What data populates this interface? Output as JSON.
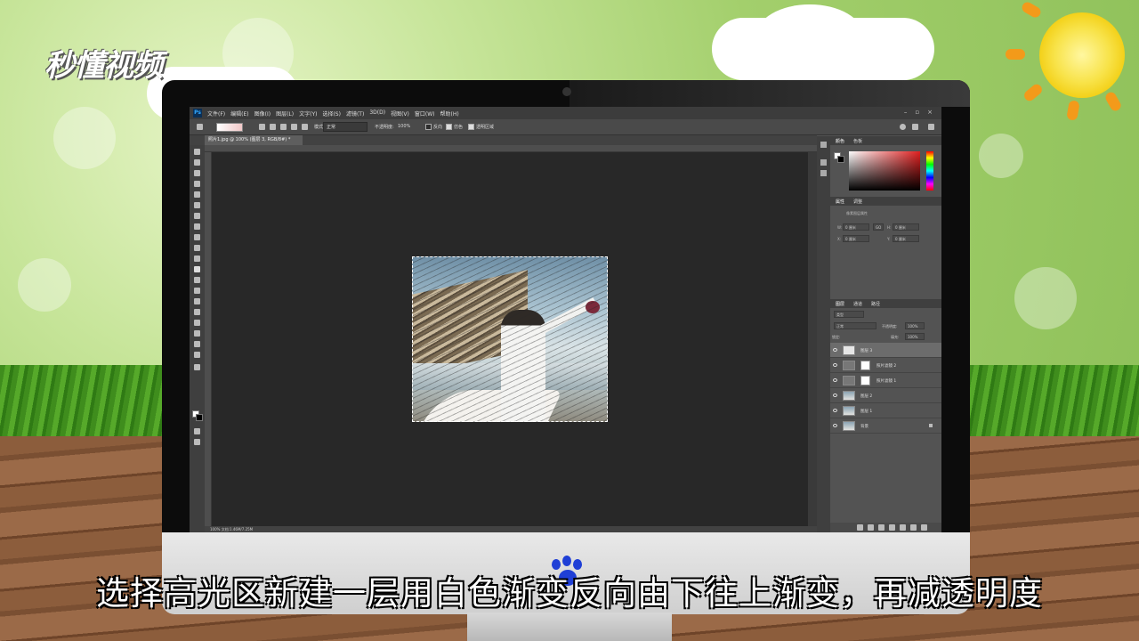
{
  "watermark": {
    "logo_text": "秒懂视频"
  },
  "subtitle": "选择高光区新建一层用白色渐变反向由下往上渐变，再减透明度",
  "photoshop": {
    "menu": [
      "文件(F)",
      "编辑(E)",
      "图像(I)",
      "图层(L)",
      "文字(Y)",
      "选择(S)",
      "滤镜(T)",
      "3D(D)",
      "视图(V)",
      "窗口(W)",
      "帮助(H)"
    ],
    "options": {
      "mode_label": "模式:",
      "mode_value": "正常",
      "opacity_label": "不透明度:",
      "opacity_value": "100%",
      "reverse_label": "反向",
      "dither_label": "仿色",
      "transparency_label": "透明区域"
    },
    "document_tab": "照片1.jpg @ 100% (图层 3, RGB/8#) *",
    "statusbar": "100%    文档:1.46M/7.25M",
    "panels": {
      "color_tabs": [
        "颜色",
        "色板"
      ],
      "props_tabs": [
        "属性",
        "调整"
      ],
      "props_title": "像素图层属性",
      "props_fields": {
        "w_label": "W:",
        "w_value": "0 厘米",
        "h_label": "H:",
        "h_value": "0 厘米",
        "x_label": "X:",
        "x_value": "0 厘米",
        "y_label": "Y:",
        "y_value": "0 厘米",
        "link": "GO"
      },
      "layers_tabs": [
        "图层",
        "通道",
        "路径"
      ],
      "layers_kind": "类型",
      "blend_mode": "正常",
      "opacity_label": "不透明度:",
      "opacity_value": "100%",
      "lock_label": "锁定:",
      "fill_label": "填充:",
      "fill_value": "100%",
      "layers": [
        {
          "name": "图层 3",
          "thumb": "blank",
          "mask": false,
          "selected": true
        },
        {
          "name": "照片滤镜 2",
          "thumb": "adj",
          "mask": true,
          "selected": false
        },
        {
          "name": "照片滤镜 1",
          "thumb": "adj",
          "mask": true,
          "selected": false
        },
        {
          "name": "图层 2",
          "thumb": "photo",
          "mask": false,
          "selected": false
        },
        {
          "name": "图层 1",
          "thumb": "photo",
          "mask": false,
          "selected": false
        },
        {
          "name": "背景",
          "thumb": "photo",
          "mask": false,
          "selected": false,
          "locked": true
        }
      ]
    }
  },
  "colors": {
    "accent_foreground": "#ffffff",
    "accent_background": "#000000",
    "picker_hue": "#e02020"
  }
}
